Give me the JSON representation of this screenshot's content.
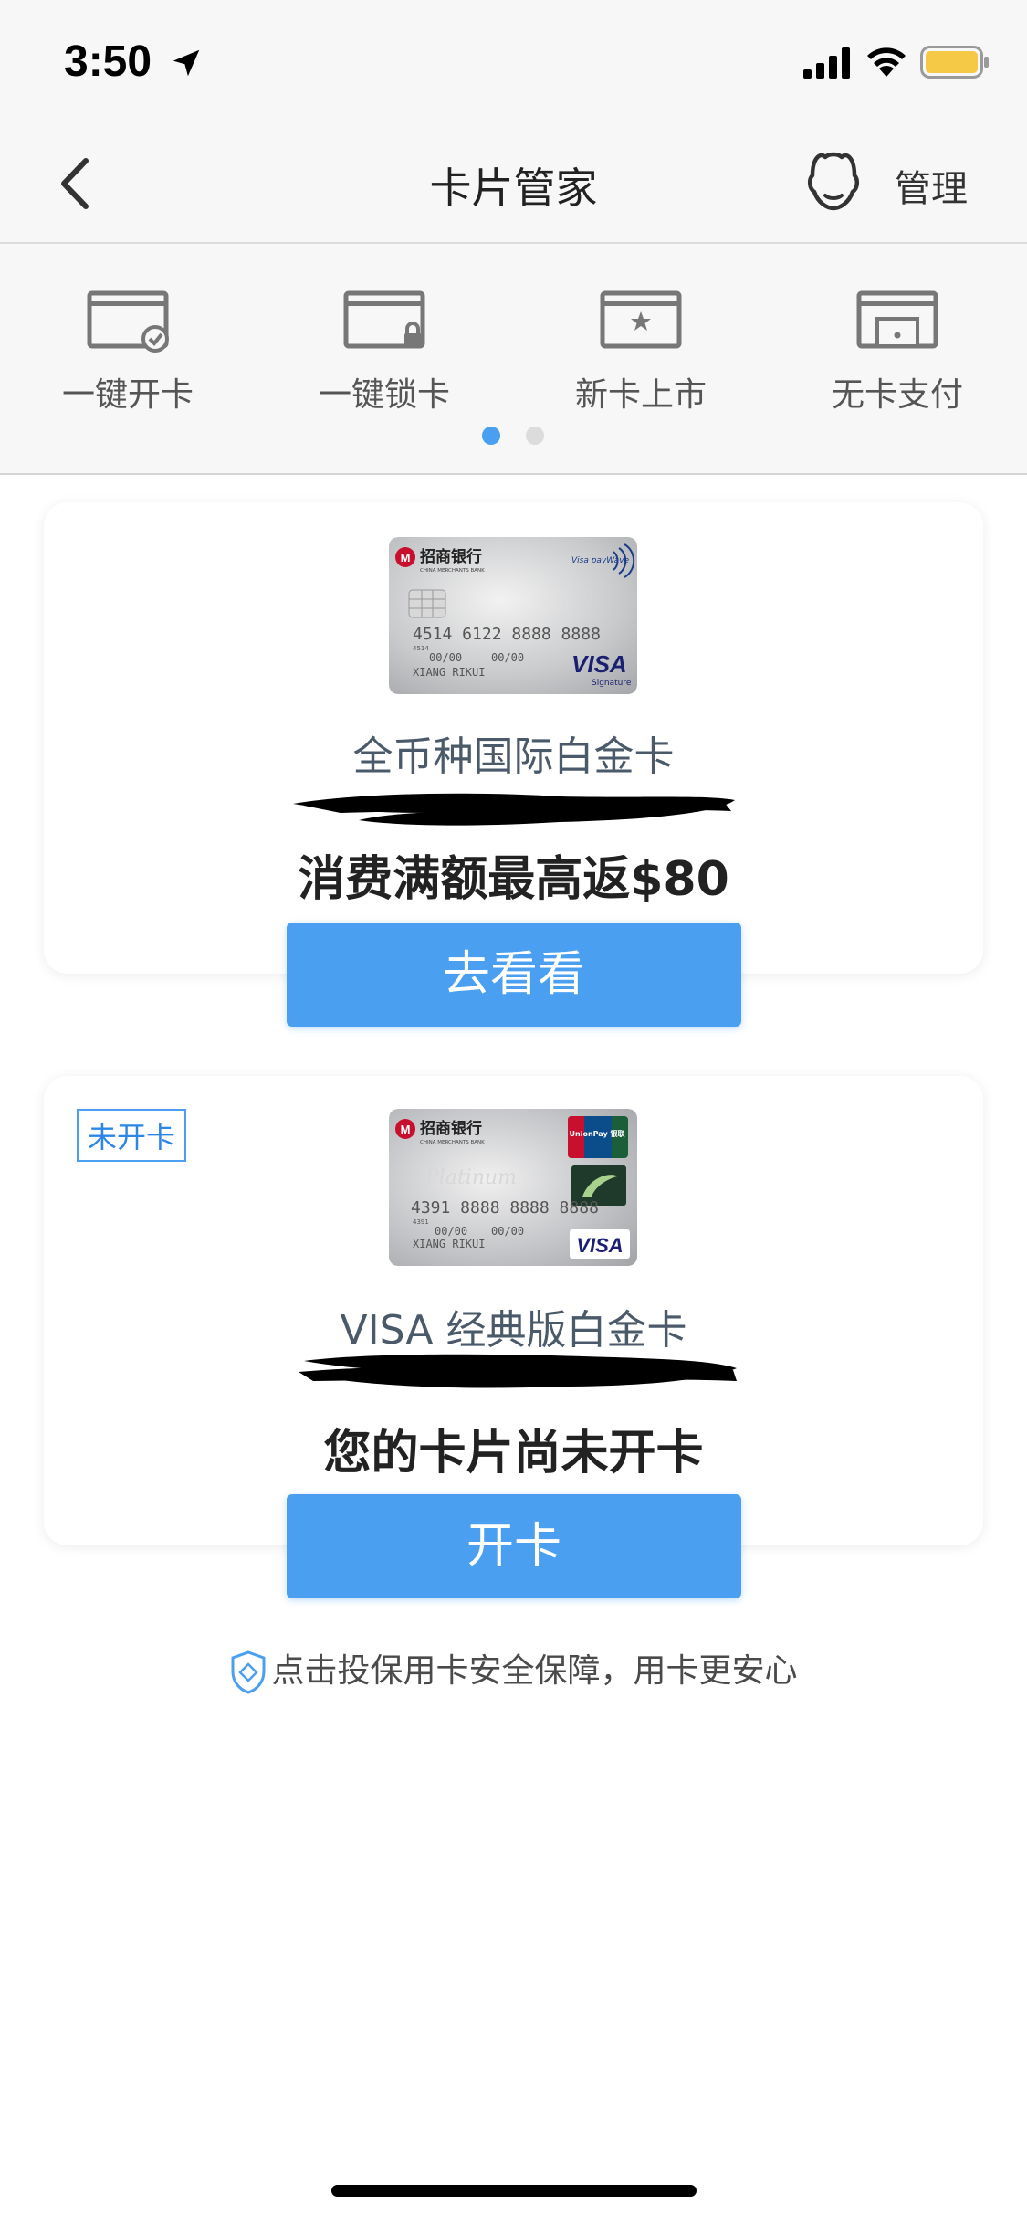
{
  "status_bar": {
    "time": "3:50",
    "icons": [
      "location-arrow-icon",
      "cellular-signal-icon",
      "wifi-icon",
      "battery-icon"
    ],
    "battery_color": "#f5c945"
  },
  "header": {
    "title": "卡片管家",
    "manage_label": "管理"
  },
  "quick_actions": [
    {
      "label": "一键开卡",
      "icon": "card-check-icon"
    },
    {
      "label": "一键锁卡",
      "icon": "card-lock-icon"
    },
    {
      "label": "新卡上市",
      "icon": "card-star-icon"
    },
    {
      "label": "无卡支付",
      "icon": "cardless-pay-icon"
    }
  ],
  "pager": {
    "active": 0,
    "count": 2
  },
  "cards": [
    {
      "name": "全币种国际白金卡",
      "message": "消费满额最高返$80",
      "button": "去看看",
      "status_tag": "",
      "image": {
        "bank": "招商银行",
        "bank_en": "CHINA MERCHANTS BANK",
        "number": "4514 6122 8888 8888",
        "number_small": "4514",
        "valid": "00/00",
        "holder": "XIANG RIKUI",
        "brand": "VISA",
        "brand_sub": "Signature",
        "contactless": "Visa payWave"
      }
    },
    {
      "name": "VISA 经典版白金卡",
      "message": "您的卡片尚未开卡",
      "button": "开卡",
      "status_tag": "未开卡",
      "image": {
        "bank": "招商银行",
        "bank_en": "CHINA MERCHANTS BANK",
        "number": "4391 8888 8888 8888",
        "number_small": "4391",
        "valid": "00/00",
        "holder": "XIANG RIKUI",
        "brand": "VISA",
        "unionpay": "UnionPay 银联",
        "script": "Platinum"
      }
    }
  ],
  "notice": "点击投保用卡安全保障，用卡更安心",
  "colors": {
    "accent": "#4a9ff0",
    "header_bg": "#f7f7f8",
    "title_text": "#4a5a6a"
  }
}
